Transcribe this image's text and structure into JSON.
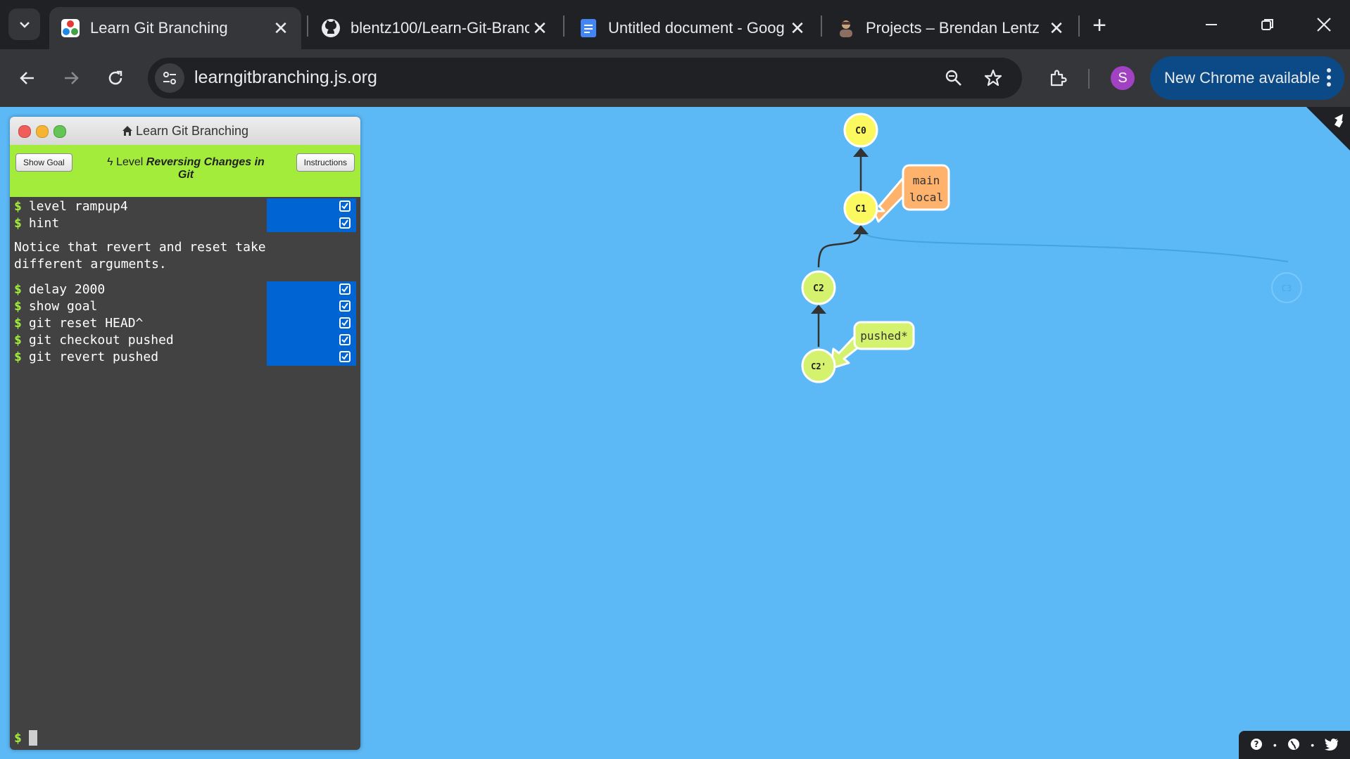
{
  "browser": {
    "tabs": [
      {
        "title": "Learn Git Branching",
        "icon": "learngitbranching-favicon",
        "active": true
      },
      {
        "title": "blentz100/Learn-Git-Branc",
        "icon": "github-icon",
        "active": false
      },
      {
        "title": "Untitled document - Goog",
        "icon": "google-docs-icon",
        "active": false
      },
      {
        "title": "Projects – Brendan Lentz",
        "icon": "profile-favicon",
        "active": false
      }
    ],
    "url": "learngitbranching.js.org",
    "profile_initial": "S",
    "update_button": "New Chrome available"
  },
  "terminal": {
    "title": "Learn Git Branching",
    "show_goal_label": "Show Goal",
    "instructions_label": "Instructions",
    "level_prefix": "Level",
    "level_name": "Reversing Changes in Git",
    "commands_group1": [
      "level rampup4",
      "hint"
    ],
    "output_text": "Notice that revert and reset take different arguments.",
    "commands_group2": [
      "delay 2000",
      "show goal",
      "git reset HEAD^",
      "git checkout pushed",
      "git revert pushed"
    ],
    "prompt": "$"
  },
  "git_tree": {
    "commits": [
      "C0",
      "C1",
      "C2",
      "C2'",
      "C3"
    ],
    "branches": [
      {
        "name": "main",
        "target": "C1",
        "color": "#ffb26b"
      },
      {
        "name": "local",
        "target": "C1",
        "color": "#ffb26b"
      },
      {
        "name": "pushed*",
        "target": "C2'",
        "color": "#d4f26e"
      }
    ],
    "commit_color": "#fcf85f",
    "faded_commit": "C3"
  },
  "colors": {
    "page_bg": "#5cb9f6",
    "terminal_bg": "#424242",
    "header_green": "#a4ec3c",
    "status_blue": "#0064d2"
  }
}
